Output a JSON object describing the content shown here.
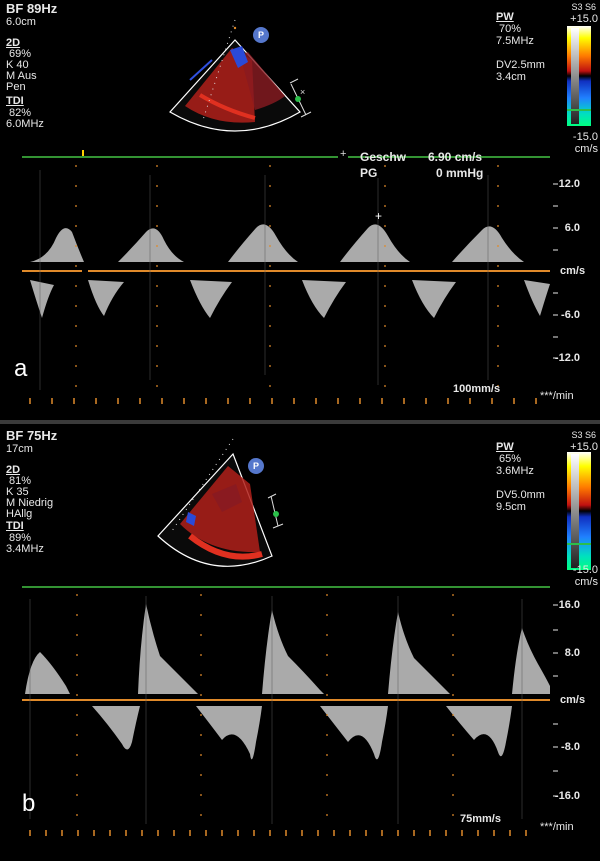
{
  "panel_a": {
    "letter": "a",
    "left_params": {
      "title": "BF 89Hz",
      "depth": "6.0cm",
      "mode_2d": "2D",
      "gain_2d": " 69%",
      "k": "K 40",
      "m": "M Aus",
      "pen": "Pen",
      "tdi": "TDI",
      "tdi_gain": " 82%",
      "freq": "6.0MHz"
    },
    "right_params": {
      "pw": "PW",
      "pw_gain": " 70%",
      "pw_freq": "7.5MHz",
      "dv": "DV2.5mm",
      "depth": "3.4cm"
    },
    "scale": {
      "header": "S3 S6",
      "top": "+15.0",
      "bottom": "-15.0",
      "unit": "cm/s"
    },
    "probe_marker": "P",
    "measurement": {
      "geschw_label": "Geschw",
      "geschw_value": "6.90 cm/s",
      "pg_label": "PG",
      "pg_value": "0 mmHg"
    },
    "axis": {
      "ticks": [
        "12.0",
        "6.0",
        "-6.0",
        "-12.0"
      ],
      "unit": "cm/s",
      "sweep": "100mm/s",
      "rate": "***/min"
    }
  },
  "panel_b": {
    "letter": "b",
    "left_params": {
      "title": "BF 75Hz",
      "depth": "17cm",
      "mode_2d": "2D",
      "gain_2d": " 81%",
      "k": "K 35",
      "m": "M Niedrig",
      "hallg": "HAllg",
      "tdi": "TDI",
      "tdi_gain": " 89%",
      "freq": "3.4MHz"
    },
    "right_params": {
      "pw": "PW",
      "pw_gain": " 65%",
      "pw_freq": "3.6MHz",
      "dv": "DV5.0mm",
      "depth": "9.5cm"
    },
    "scale": {
      "header": "S3 S6",
      "top": "+15.0",
      "bottom": "-15.0",
      "unit": "cm/s"
    },
    "probe_marker": "P",
    "axis": {
      "ticks": [
        "16.0",
        "8.0",
        "-8.0",
        "-16.0"
      ],
      "unit": "cm/s",
      "sweep": "75mm/s",
      "rate": "***/min"
    }
  },
  "colors": {
    "baseline": "#e08a2a",
    "top_line": "#44c444",
    "doppler_red": "#c8201a",
    "doppler_blue": "#2a4ad8"
  }
}
